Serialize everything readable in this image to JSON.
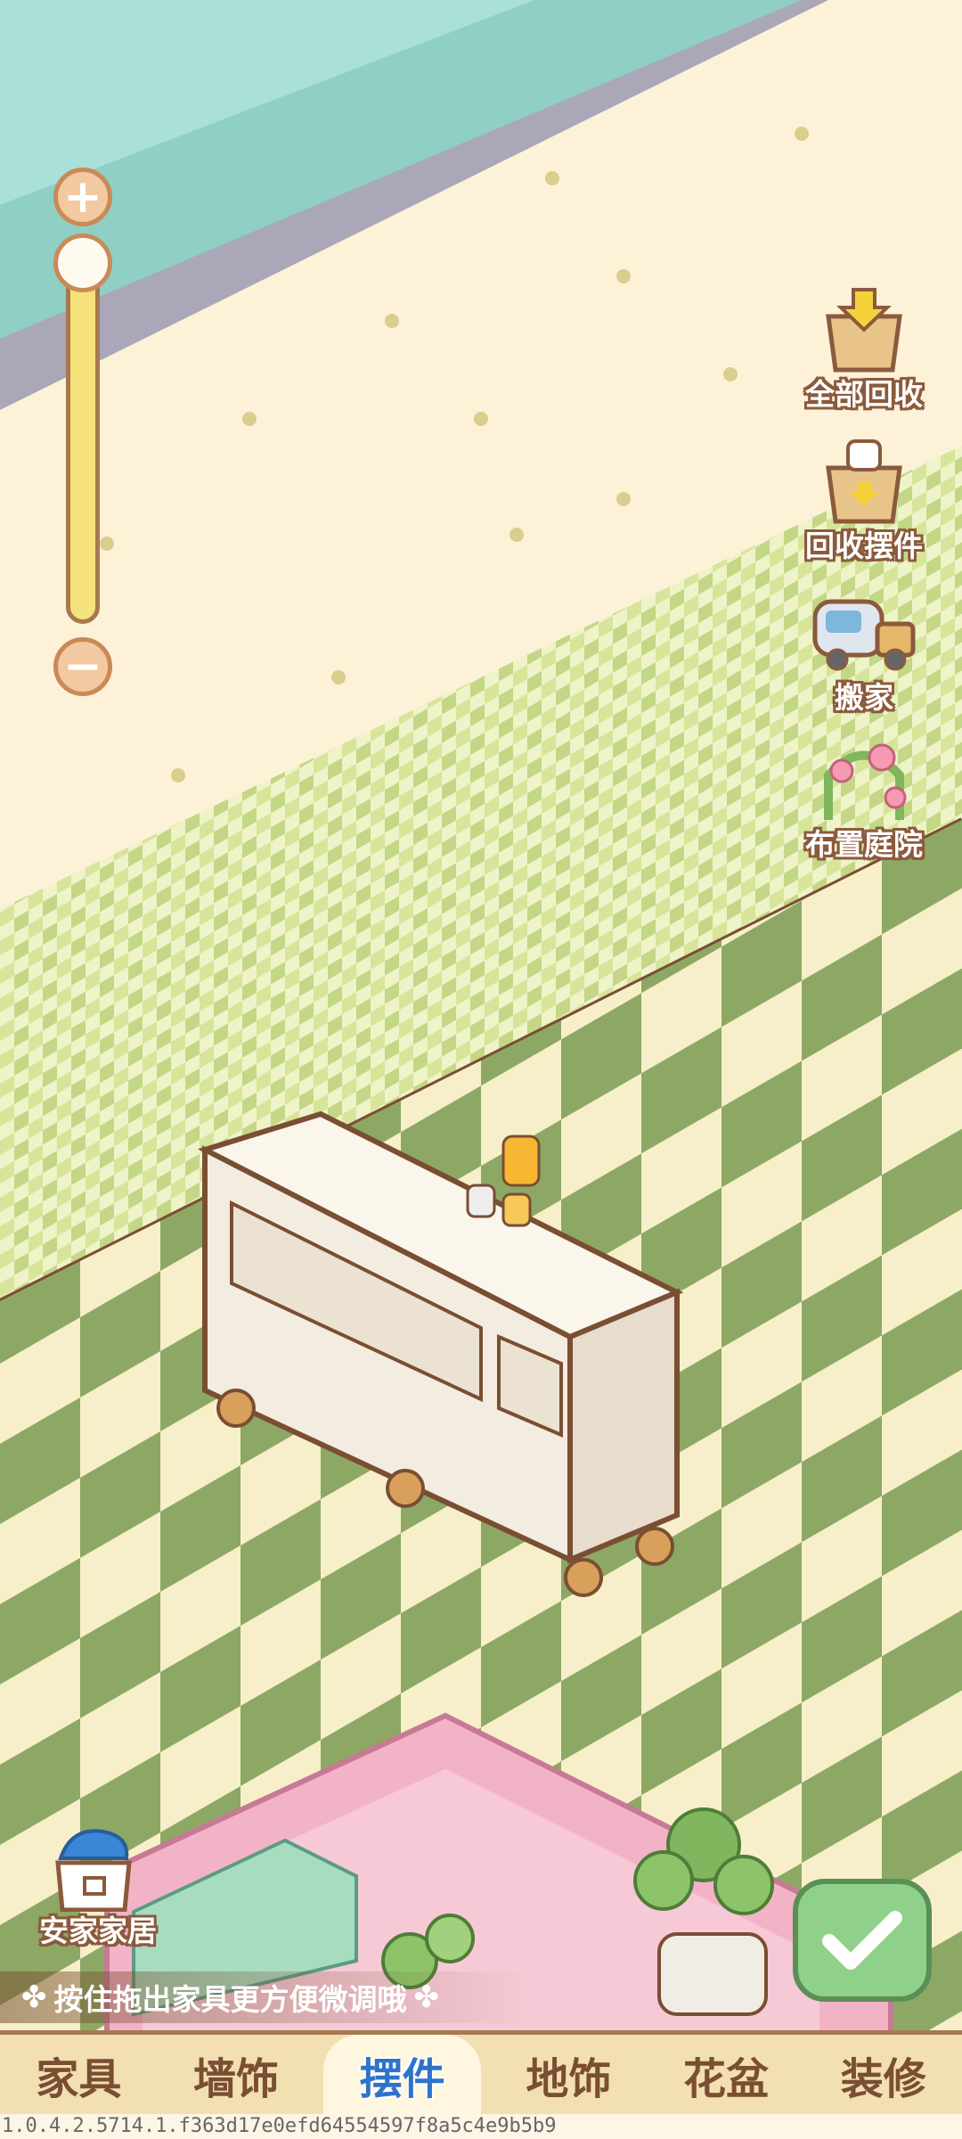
{
  "zoom": {
    "plus_icon": "+",
    "minus_icon": "−"
  },
  "side_buttons": [
    {
      "label": "全部回收",
      "icon": "box-arrow-icon"
    },
    {
      "label": "回收摆件",
      "icon": "box-cup-icon"
    },
    {
      "label": "搬家",
      "icon": "truck-icon"
    },
    {
      "label": "布置庭院",
      "icon": "flower-arch-icon"
    }
  ],
  "shop": {
    "label": "安家家居",
    "icon": "shop-bag-icon"
  },
  "hint": {
    "text": "按住拖出家具更方便微调哦"
  },
  "confirm": {
    "icon": "checkmark-icon"
  },
  "tabs": [
    {
      "label": "家具",
      "active": false
    },
    {
      "label": "墙饰",
      "active": false
    },
    {
      "label": "摆件",
      "active": true
    },
    {
      "label": "地饰",
      "active": false
    },
    {
      "label": "花盆",
      "active": false
    },
    {
      "label": "装修",
      "active": false
    }
  ],
  "version": "1.0.4.2.5714.1.f363d17e0efd64554597f8a5c4e9b5b9",
  "colors": {
    "accent_active": "#2f73c9",
    "floor_green": "#8da865",
    "floor_cream": "#f7efc9",
    "tabbar_bg": "#f2dfb2"
  }
}
